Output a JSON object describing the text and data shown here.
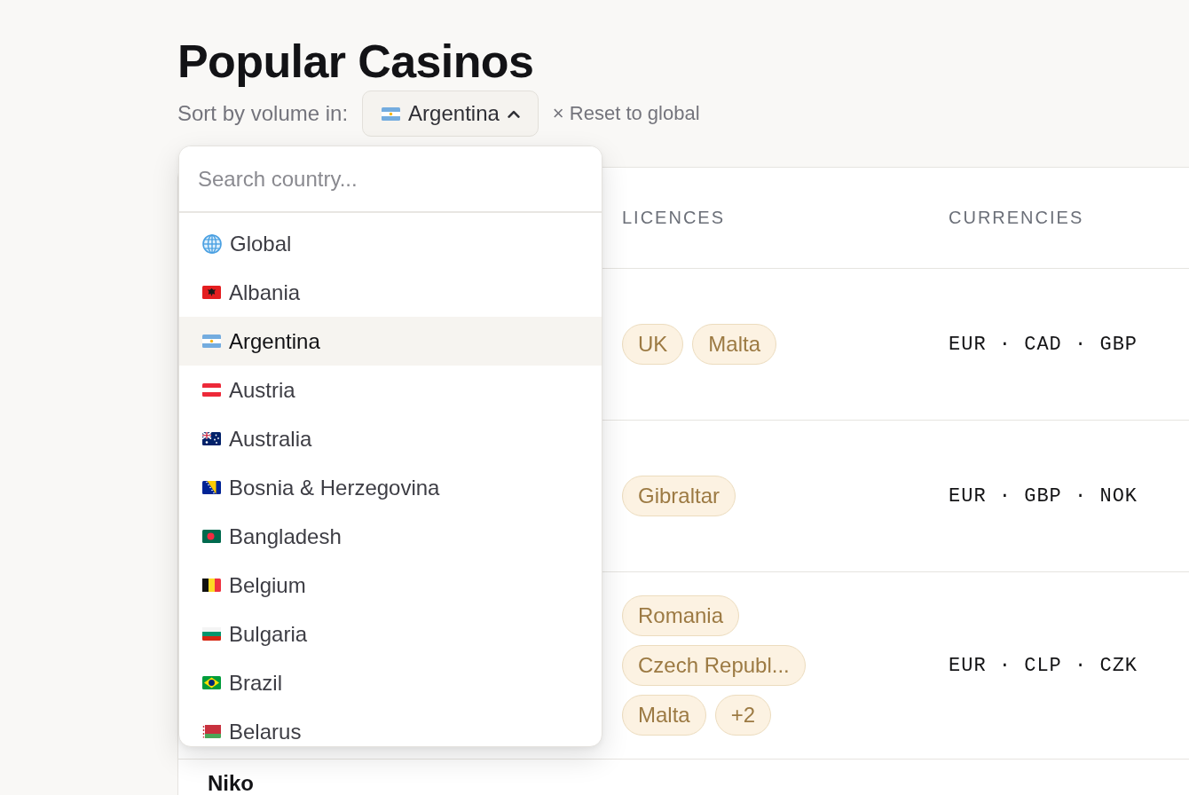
{
  "page": {
    "title": "Popular Casinos"
  },
  "sort": {
    "label": "Sort by volume in:",
    "select": {
      "kind": "ar",
      "value": "Argentina",
      "expanded": true
    },
    "reset": "× Reset to global"
  },
  "dropdown": {
    "search": {
      "placeholder": "Search country..."
    },
    "items": [
      {
        "kind": "globe",
        "label": "Global",
        "selected": false
      },
      {
        "kind": "al",
        "label": "Albania",
        "selected": false
      },
      {
        "kind": "ar",
        "label": "Argentina",
        "selected": true
      },
      {
        "kind": "at",
        "label": "Austria",
        "selected": false
      },
      {
        "kind": "au",
        "label": "Australia",
        "selected": false
      },
      {
        "kind": "ba",
        "label": "Bosnia & Herzegovina",
        "selected": false
      },
      {
        "kind": "bd",
        "label": "Bangladesh",
        "selected": false
      },
      {
        "kind": "be",
        "label": "Belgium",
        "selected": false
      },
      {
        "kind": "bg",
        "label": "Bulgaria",
        "selected": false
      },
      {
        "kind": "br",
        "label": "Brazil",
        "selected": false
      },
      {
        "kind": "by",
        "label": "Belarus",
        "selected": false
      }
    ]
  },
  "table": {
    "columns": [
      {
        "label": "LICENCES"
      },
      {
        "label": "CURRENCIES"
      }
    ],
    "rows": [
      {
        "licences": [
          "UK",
          "Malta"
        ],
        "currencies": "EUR · CAD · GBP"
      },
      {
        "licences": [
          "Gibraltar"
        ],
        "currencies": "EUR · GBP · NOK"
      },
      {
        "licences": [
          "Romania",
          "Czech Republ...",
          "Malta",
          "+2"
        ],
        "currencies": "EUR · CLP · CZK"
      },
      {
        "column_1": "Niko"
      }
    ]
  }
}
